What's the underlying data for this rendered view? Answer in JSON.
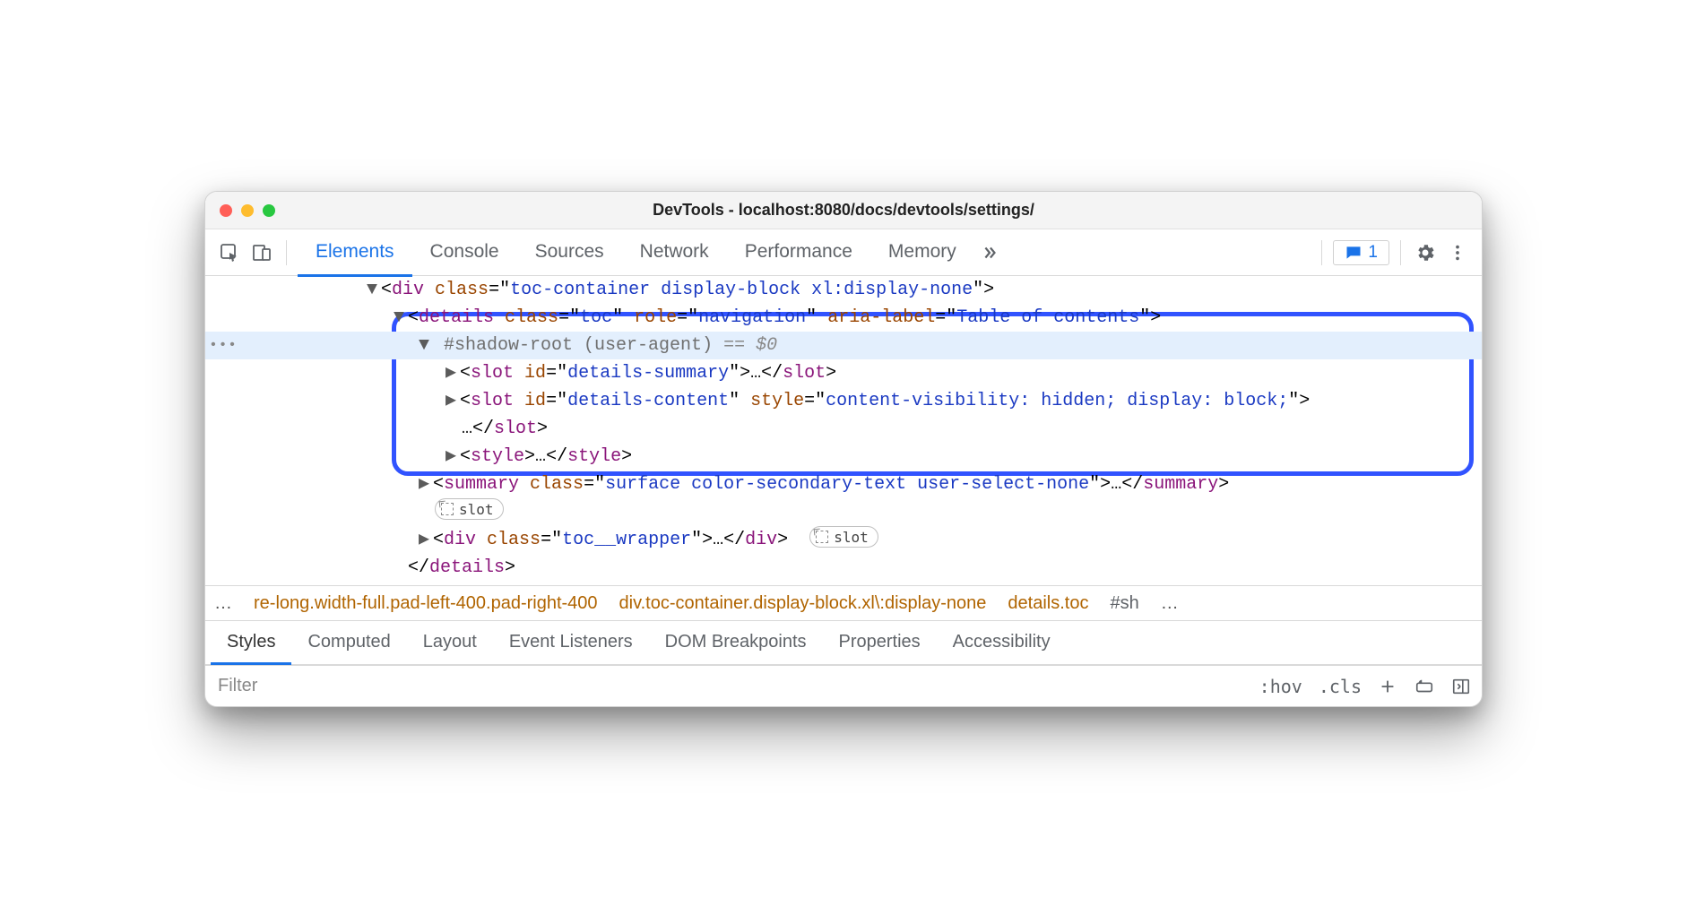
{
  "window": {
    "title": "DevTools - localhost:8080/docs/devtools/settings/"
  },
  "tabs": {
    "items": [
      "Elements",
      "Console",
      "Sources",
      "Network",
      "Performance",
      "Memory"
    ],
    "active_index": 0,
    "issues_count": "1"
  },
  "dom": {
    "line_div": {
      "tag": "div",
      "class_attr": "class",
      "class_val": "toc-container display-block xl:display-none"
    },
    "line_details": {
      "tag": "details",
      "class_attr": "class",
      "class_val": "toc",
      "role_attr": "role",
      "role_val": "navigation",
      "aria_attr": "aria-label",
      "aria_val": "Table of contents"
    },
    "line_shadow": {
      "text": "#shadow-root (user-agent)",
      "eq": "== $0"
    },
    "line_slot_summary": {
      "tag": "slot",
      "id_attr": "id",
      "id_val": "details-summary",
      "dots": "…"
    },
    "line_slot_content": {
      "tag": "slot",
      "id_attr": "id",
      "id_val": "details-content",
      "style_attr": "style",
      "style_val": "content-visibility: hidden; display: block;",
      "dots": "…"
    },
    "line_style": {
      "tag": "style",
      "dots": "…"
    },
    "line_summary": {
      "tag": "summary",
      "class_attr": "class",
      "class_val": "surface color-secondary-text user-select-none",
      "dots": "…"
    },
    "line_toc_wrapper": {
      "tag": "div",
      "class_attr": "class",
      "class_val": "toc__wrapper",
      "dots": "…"
    },
    "line_details_close": "details",
    "gutter_dots": "•••",
    "slot_badge": "slot"
  },
  "crumbs": {
    "leading_dots": "…",
    "c1": "re-long.width-full.pad-left-400.pad-right-400",
    "c2": "div.toc-container.display-block.xl\\:display-none",
    "c3": "details.toc",
    "c4": "#sh",
    "trailing_dots": "…"
  },
  "subtabs": {
    "items": [
      "Styles",
      "Computed",
      "Layout",
      "Event Listeners",
      "DOM Breakpoints",
      "Properties",
      "Accessibility"
    ],
    "active_index": 0
  },
  "stylesbar": {
    "filter_placeholder": "Filter",
    "hov": ":hov",
    "cls": ".cls"
  }
}
